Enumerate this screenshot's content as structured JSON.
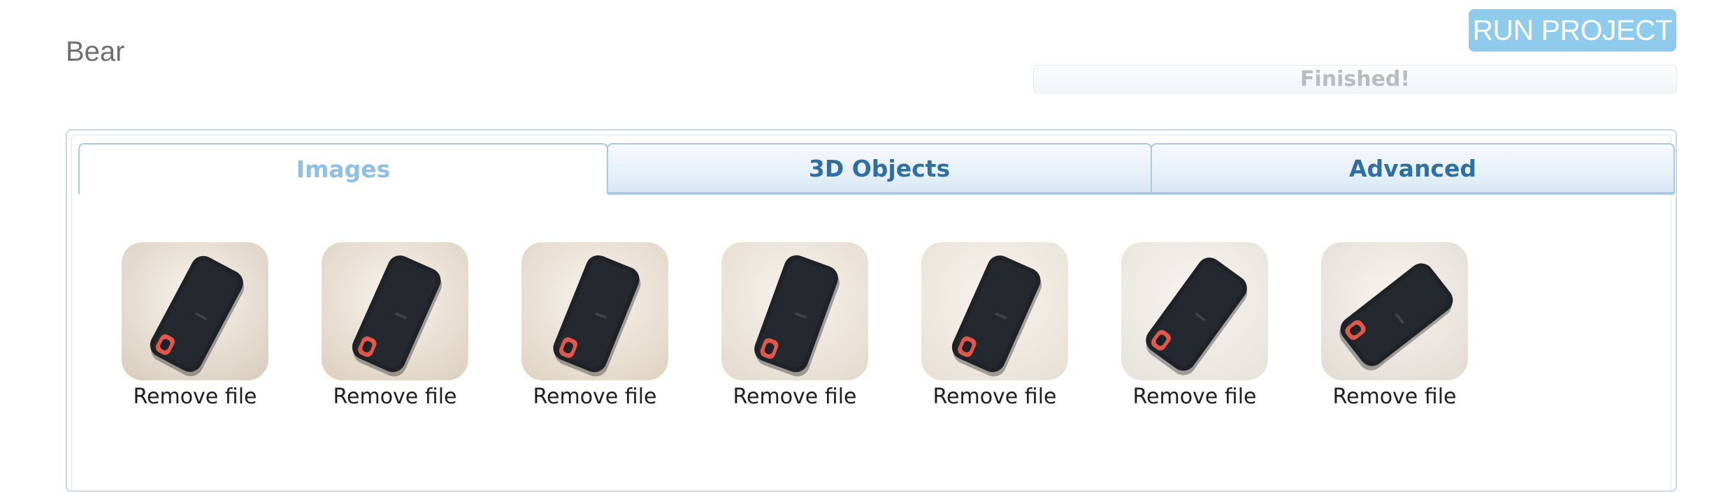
{
  "project": {
    "title": "Bear"
  },
  "header": {
    "run_button_label": "RUN PROJECT",
    "status_text": "Finished!",
    "progress_fraction": 1.0
  },
  "tabs": [
    {
      "label": "Images",
      "active": true
    },
    {
      "label": "3D Objects",
      "active": false
    },
    {
      "label": "Advanced",
      "active": false
    }
  ],
  "images": [
    {
      "remove_label": "Remove file"
    },
    {
      "remove_label": "Remove file"
    },
    {
      "remove_label": "Remove file"
    },
    {
      "remove_label": "Remove file"
    },
    {
      "remove_label": "Remove file"
    },
    {
      "remove_label": "Remove file"
    },
    {
      "remove_label": "Remove file"
    }
  ],
  "colors": {
    "run_button_bg": "#8fcbec",
    "active_tab_text": "#8fc0e4",
    "inactive_tab_text": "#2f6fa1",
    "tab_border": "#a9c8e3",
    "status_text": "#b9bcbf",
    "device_body": "#1f2328",
    "device_accent": "#e2584a"
  },
  "icons": {
    "thumbnail_subject": "portable-ssd-photo"
  }
}
